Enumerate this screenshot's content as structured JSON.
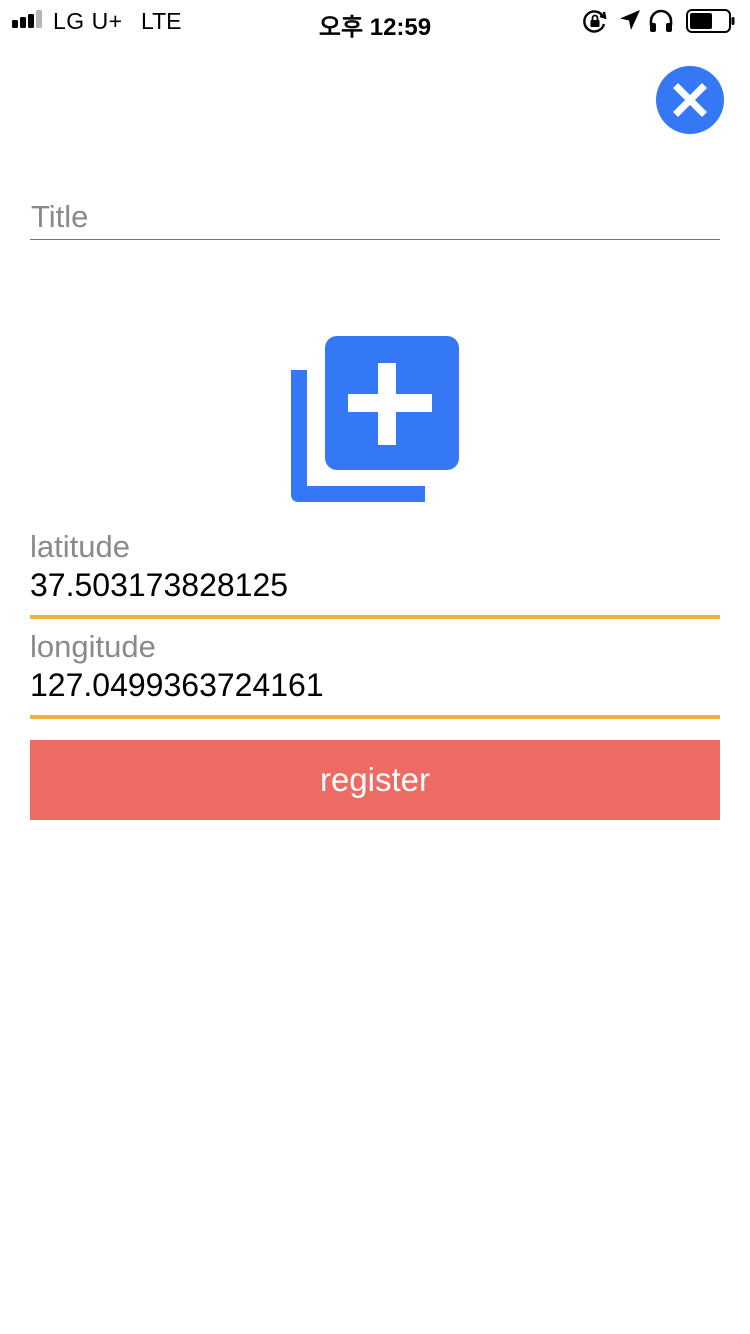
{
  "status_bar": {
    "carrier": "LG U+",
    "network": "LTE",
    "time": "오후 12:59",
    "signal_bars_active": 3,
    "signal_bars_total": 4,
    "battery_level": 0.6,
    "icons": [
      "rotation-lock-icon",
      "location-icon",
      "headphones-icon",
      "battery-icon"
    ]
  },
  "close_button": {
    "icon": "close-icon",
    "color": "#3478f6"
  },
  "form": {
    "title": {
      "placeholder": "Title",
      "value": ""
    },
    "add_photo": {
      "icon": "add-photo-icon",
      "color": "#3478f6"
    },
    "latitude": {
      "label": "latitude",
      "value": "37.503173828125"
    },
    "longitude": {
      "label": "longitude",
      "value": "127.0499363724161"
    },
    "underline_color": "#ebb43b"
  },
  "register_button": {
    "label": "register",
    "color": "#ee6b64"
  }
}
